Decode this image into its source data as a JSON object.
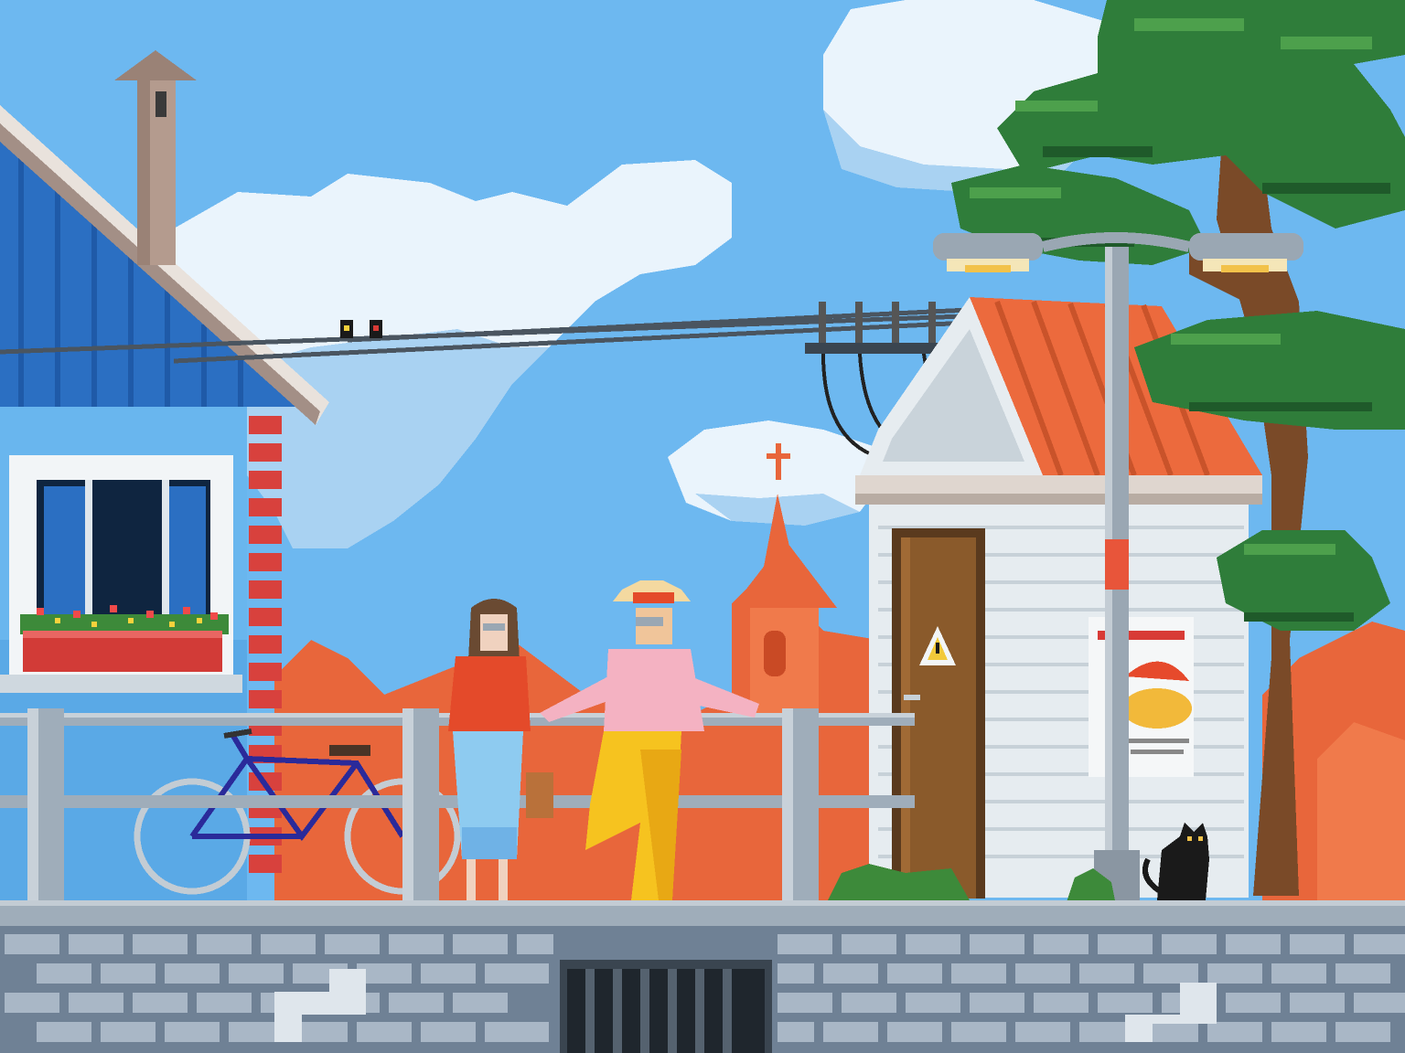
{
  "scene": {
    "poster": {
      "title_text": ""
    }
  },
  "colors": {
    "sky": "#6db8f0",
    "sky_dark": "#3b8fdd",
    "cloud": "#eaf4fc",
    "cloud_shade": "#a9d2f2",
    "rooftops": "#e8663b",
    "rooftops_light": "#f07a4b",
    "house_blue": "#2b6fc2",
    "house_blue_light": "#69b6ee",
    "brick_red": "#d8413d",
    "wall_grey": "#6f8195",
    "wall_brick": "#a9b7c6",
    "kiosk_wall": "#e6ecf0",
    "tile_roof": "#ec6a3d",
    "door_brown": "#8a5a2b",
    "tree_green": "#2f7d3a",
    "tree_trunk": "#7a4a28",
    "railing": "#9fadba",
    "lamp_post": "#9aa7b3"
  }
}
